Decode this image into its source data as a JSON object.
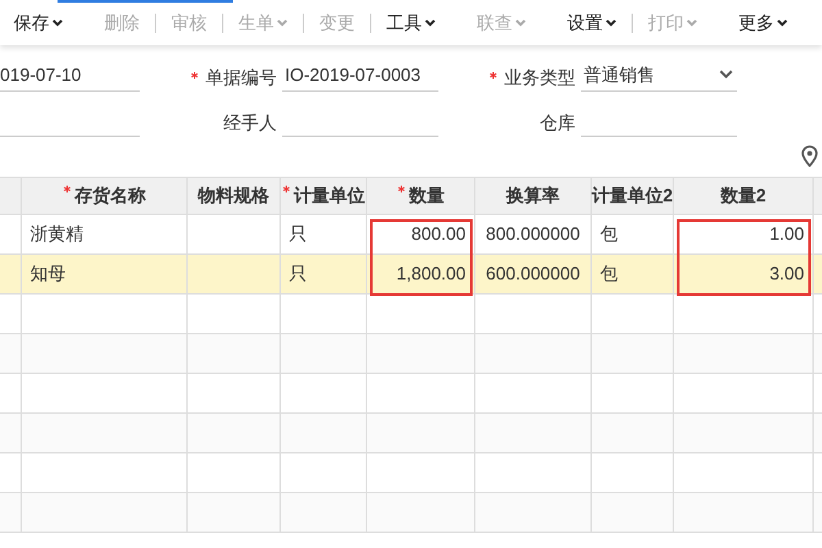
{
  "toolbar": [
    {
      "label": "保存",
      "dropdown": true,
      "disabled": false
    },
    {
      "label": "删除",
      "dropdown": false,
      "disabled": true
    },
    {
      "label": "审核",
      "dropdown": false,
      "disabled": true
    },
    {
      "label": "生单",
      "dropdown": true,
      "disabled": true
    },
    {
      "label": "变更",
      "dropdown": false,
      "disabled": true
    },
    {
      "label": "工具",
      "dropdown": true,
      "disabled": false
    },
    {
      "label": "联查",
      "dropdown": true,
      "disabled": true
    },
    {
      "label": "设置",
      "dropdown": true,
      "disabled": false
    },
    {
      "label": "打印",
      "dropdown": true,
      "disabled": true
    },
    {
      "label": "更多",
      "dropdown": true,
      "disabled": false
    }
  ],
  "form": {
    "rows": [
      [
        {
          "value": "019-07-10"
        },
        {
          "label": "单据编号",
          "required": true,
          "value": "IO-2019-07-0003"
        },
        {
          "label": "业务类型",
          "required": true,
          "value": "普通销售",
          "kind": "select"
        }
      ],
      [
        {},
        {
          "label": "经手人",
          "required": false
        },
        {
          "label": "仓库",
          "required": false
        }
      ]
    ]
  },
  "table": {
    "columns": [
      {
        "label": "存货名称",
        "required": true,
        "highlighted": false
      },
      {
        "label": "物料规格",
        "required": false,
        "highlighted": false
      },
      {
        "label": "计量单位",
        "required": true,
        "highlighted": false
      },
      {
        "label": "数量",
        "required": true,
        "highlighted": true
      },
      {
        "label": "换算率",
        "required": false,
        "highlighted": false
      },
      {
        "label": "计量单位2",
        "required": false,
        "highlighted": false
      },
      {
        "label": "数量2",
        "required": false,
        "highlighted": true
      }
    ],
    "rows": [
      {
        "selected": false,
        "cells": [
          "浙黄精",
          "",
          "只",
          "800.00",
          "800.000000",
          "包",
          "1.00"
        ]
      },
      {
        "selected": true,
        "cells": [
          "知母",
          "",
          "只",
          "1,800.00",
          "600.000000",
          "包",
          "3.00"
        ]
      }
    ]
  }
}
